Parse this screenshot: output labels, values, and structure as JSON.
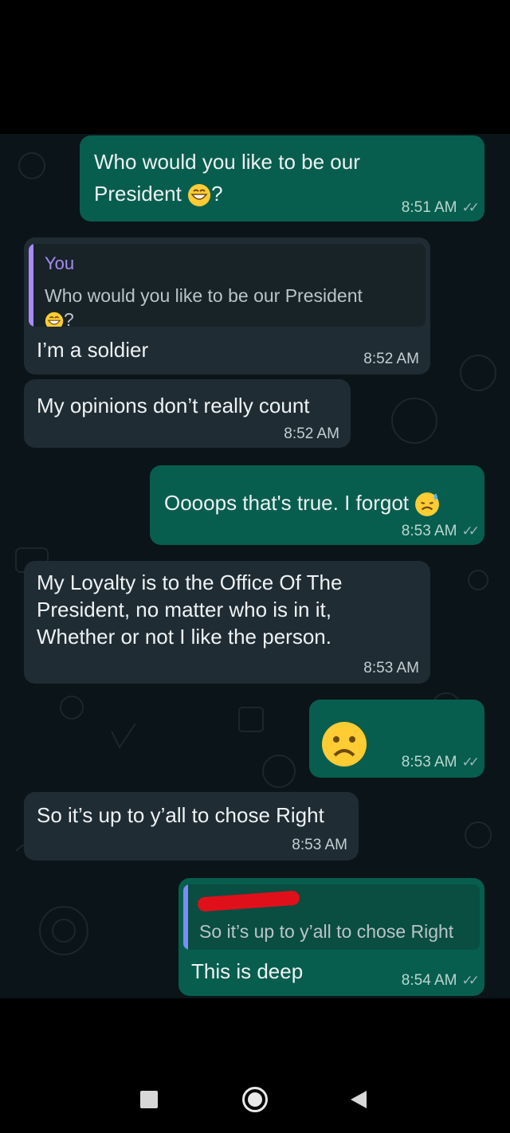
{
  "messages": [
    {
      "id": "m1",
      "direction": "outgoing",
      "text_line1": "Who would you like to be our",
      "text_line2": "President",
      "suffix": "?",
      "time": "8:51 AM",
      "emoji": "grinning-face"
    },
    {
      "id": "m2",
      "direction": "incoming",
      "quote_author": "You",
      "quote_line1": "Who would you like to be our President",
      "quote_suffix": "?",
      "text": "I’m a soldier",
      "time": "8:52 AM"
    },
    {
      "id": "m3",
      "direction": "incoming",
      "text": "My opinions don’t really count",
      "time": "8:52 AM"
    },
    {
      "id": "m4",
      "direction": "outgoing",
      "text": "Oooops that's true. I forgot",
      "time": "8:53 AM",
      "emoji": "sweat-face"
    },
    {
      "id": "m5",
      "direction": "incoming",
      "line1": "My Loyalty is to the Office Of The",
      "line2": "President, no matter who is in it,",
      "line3": "Whether or not I like the person.",
      "time": "8:53 AM"
    },
    {
      "id": "m6",
      "direction": "outgoing",
      "emoji": "frowning-face",
      "time": "8:53 AM"
    },
    {
      "id": "m7",
      "direction": "incoming",
      "text": "So it’s up to y’all to chose Right",
      "time": "8:53 AM"
    },
    {
      "id": "m8",
      "direction": "outgoing",
      "quote_text": "So it’s up to y’all to chose Right",
      "text": "This is deep",
      "time": "8:54 AM"
    }
  ],
  "colors": {
    "outgoing_bubble": "#075e4e",
    "incoming_bubble": "#1f2c33",
    "background": "#0b1418",
    "quote_you": "#a88bf5",
    "quote_other": "#7c8cf8",
    "redaction": "#e0101a"
  }
}
